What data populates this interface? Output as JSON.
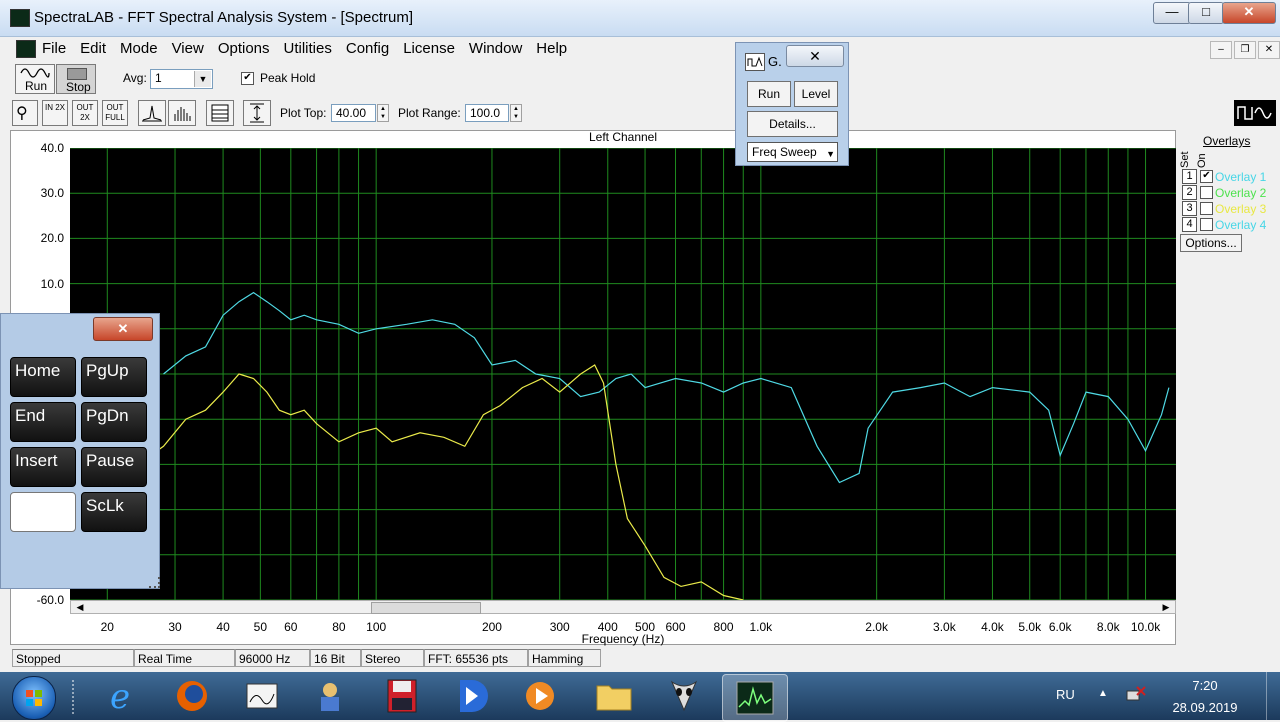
{
  "window": {
    "title": "SpectraLAB - FFT Spectral Analysis System - [Spectrum]",
    "min": "—",
    "max": "□",
    "close": "✕"
  },
  "menu": [
    "File",
    "Edit",
    "Mode",
    "View",
    "Options",
    "Utilities",
    "Config",
    "License",
    "Window",
    "Help"
  ],
  "mdi": {
    "min": "–",
    "restore": "❐",
    "close": "✕"
  },
  "toolbar1": {
    "run": "Run",
    "stop": "Stop",
    "avg_label": "Avg:",
    "avg_value": "1",
    "peak_hold_label": "Peak Hold",
    "peak_hold_check": "✔"
  },
  "toolbar2": {
    "zoom": [
      "⚲",
      "IN 2X",
      "OUT 2X",
      "OUT FULL"
    ],
    "plot_top_label": "Plot Top:",
    "plot_top_value": "40.00",
    "plot_range_label": "Plot Range:",
    "plot_range_value": "100.0"
  },
  "chart_data": {
    "type": "line",
    "title": "Left Channel",
    "xlabel": "Frequency (Hz)",
    "ylabel": "",
    "x_scale": "log",
    "xlim": [
      16,
      12000
    ],
    "ylim": [
      -60,
      40
    ],
    "y_ticks": [
      "40.0",
      "30.0",
      "20.0",
      "10.0",
      "-60.0"
    ],
    "x_ticks": [
      {
        "v": 20,
        "l": "20"
      },
      {
        "v": 30,
        "l": "30"
      },
      {
        "v": 40,
        "l": "40"
      },
      {
        "v": 50,
        "l": "50"
      },
      {
        "v": 60,
        "l": "60"
      },
      {
        "v": 80,
        "l": "80"
      },
      {
        "v": 100,
        "l": "100"
      },
      {
        "v": 200,
        "l": "200"
      },
      {
        "v": 300,
        "l": "300"
      },
      {
        "v": 400,
        "l": "400"
      },
      {
        "v": 500,
        "l": "500"
      },
      {
        "v": 600,
        "l": "600"
      },
      {
        "v": 800,
        "l": "800"
      },
      {
        "v": 1000,
        "l": "1.0k"
      },
      {
        "v": 2000,
        "l": "2.0k"
      },
      {
        "v": 3000,
        "l": "3.0k"
      },
      {
        "v": 4000,
        "l": "4.0k"
      },
      {
        "v": 5000,
        "l": "5.0k"
      },
      {
        "v": 6000,
        "l": "6.0k"
      },
      {
        "v": 8000,
        "l": "8.0k"
      },
      {
        "v": 10000,
        "l": "10.0k"
      }
    ],
    "grid": true,
    "series": [
      {
        "color": "#4fd9e4",
        "points": [
          [
            28,
            -10
          ],
          [
            32,
            -6
          ],
          [
            36,
            -4
          ],
          [
            40,
            3
          ],
          [
            44,
            6
          ],
          [
            48,
            8
          ],
          [
            52,
            6
          ],
          [
            56,
            4
          ],
          [
            60,
            2
          ],
          [
            65,
            3
          ],
          [
            70,
            2
          ],
          [
            80,
            1
          ],
          [
            90,
            -1
          ],
          [
            100,
            0
          ],
          [
            120,
            1
          ],
          [
            140,
            2
          ],
          [
            160,
            1
          ],
          [
            180,
            -2
          ],
          [
            200,
            -8
          ],
          [
            230,
            -7
          ],
          [
            260,
            -10
          ],
          [
            300,
            -11
          ],
          [
            340,
            -15
          ],
          [
            380,
            -14
          ],
          [
            420,
            -11
          ],
          [
            460,
            -10
          ],
          [
            500,
            -13
          ],
          [
            600,
            -11
          ],
          [
            700,
            -12
          ],
          [
            800,
            -14
          ],
          [
            900,
            -12
          ],
          [
            1000,
            -11
          ],
          [
            1200,
            -13
          ],
          [
            1400,
            -26
          ],
          [
            1600,
            -34
          ],
          [
            1800,
            -32
          ],
          [
            1900,
            -22
          ],
          [
            2200,
            -14
          ],
          [
            2600,
            -13
          ],
          [
            3000,
            -12
          ],
          [
            3500,
            -15
          ],
          [
            4000,
            -13
          ],
          [
            5000,
            -14
          ],
          [
            5600,
            -18
          ],
          [
            6000,
            -28
          ],
          [
            6500,
            -21
          ],
          [
            7000,
            -14
          ],
          [
            8000,
            -15
          ],
          [
            9000,
            -20
          ],
          [
            10000,
            -27
          ],
          [
            11000,
            -19
          ],
          [
            11500,
            -13
          ]
        ]
      },
      {
        "color": "#eaea4a",
        "points": [
          [
            20,
            -37
          ],
          [
            24,
            -30
          ],
          [
            28,
            -26
          ],
          [
            32,
            -20
          ],
          [
            36,
            -18
          ],
          [
            40,
            -14
          ],
          [
            44,
            -10
          ],
          [
            48,
            -11
          ],
          [
            52,
            -14
          ],
          [
            56,
            -18
          ],
          [
            60,
            -19
          ],
          [
            65,
            -18
          ],
          [
            70,
            -21
          ],
          [
            80,
            -25
          ],
          [
            90,
            -23
          ],
          [
            100,
            -22
          ],
          [
            110,
            -25
          ],
          [
            130,
            -23
          ],
          [
            150,
            -24
          ],
          [
            170,
            -26
          ],
          [
            190,
            -19
          ],
          [
            210,
            -17
          ],
          [
            240,
            -13
          ],
          [
            270,
            -11
          ],
          [
            300,
            -14
          ],
          [
            340,
            -10
          ],
          [
            370,
            -8
          ],
          [
            390,
            -12
          ],
          [
            420,
            -30
          ],
          [
            450,
            -42
          ],
          [
            500,
            -48
          ],
          [
            560,
            -55
          ],
          [
            620,
            -57
          ],
          [
            700,
            -56
          ],
          [
            800,
            -59
          ],
          [
            900,
            -60
          ]
        ]
      }
    ]
  },
  "overlays": {
    "title": "Overlays",
    "set_label": "Set",
    "on_label": "On",
    "items": [
      {
        "num": "1",
        "label": "Overlay 1",
        "checked": "✔",
        "color": "#47d6e6"
      },
      {
        "num": "2",
        "label": "Overlay 2",
        "checked": "",
        "color": "#4ee24e"
      },
      {
        "num": "3",
        "label": "Overlay 3",
        "checked": "",
        "color": "#e8e844"
      },
      {
        "num": "4",
        "label": "Overlay 4",
        "checked": "",
        "color": "#47d6e6"
      }
    ],
    "options_btn": "Options..."
  },
  "generator": {
    "title": "G.",
    "close": "✕",
    "run": "Run",
    "level": "Level",
    "details": "Details...",
    "mode": "Freq Sweep"
  },
  "keypad": {
    "close": "✕",
    "keys": [
      "Home",
      "PgUp",
      "End",
      "PgDn",
      "Insert",
      "Pause",
      "",
      "ScLk"
    ]
  },
  "status": [
    "Stopped",
    "Real Time",
    "96000 Hz",
    "16 Bit",
    "Stereo",
    "FFT: 65536 pts",
    "Hamming"
  ],
  "taskbar": {
    "lang": "RU",
    "time": "7:20",
    "date": "28.09.2019",
    "tray_arrow": "▲"
  }
}
